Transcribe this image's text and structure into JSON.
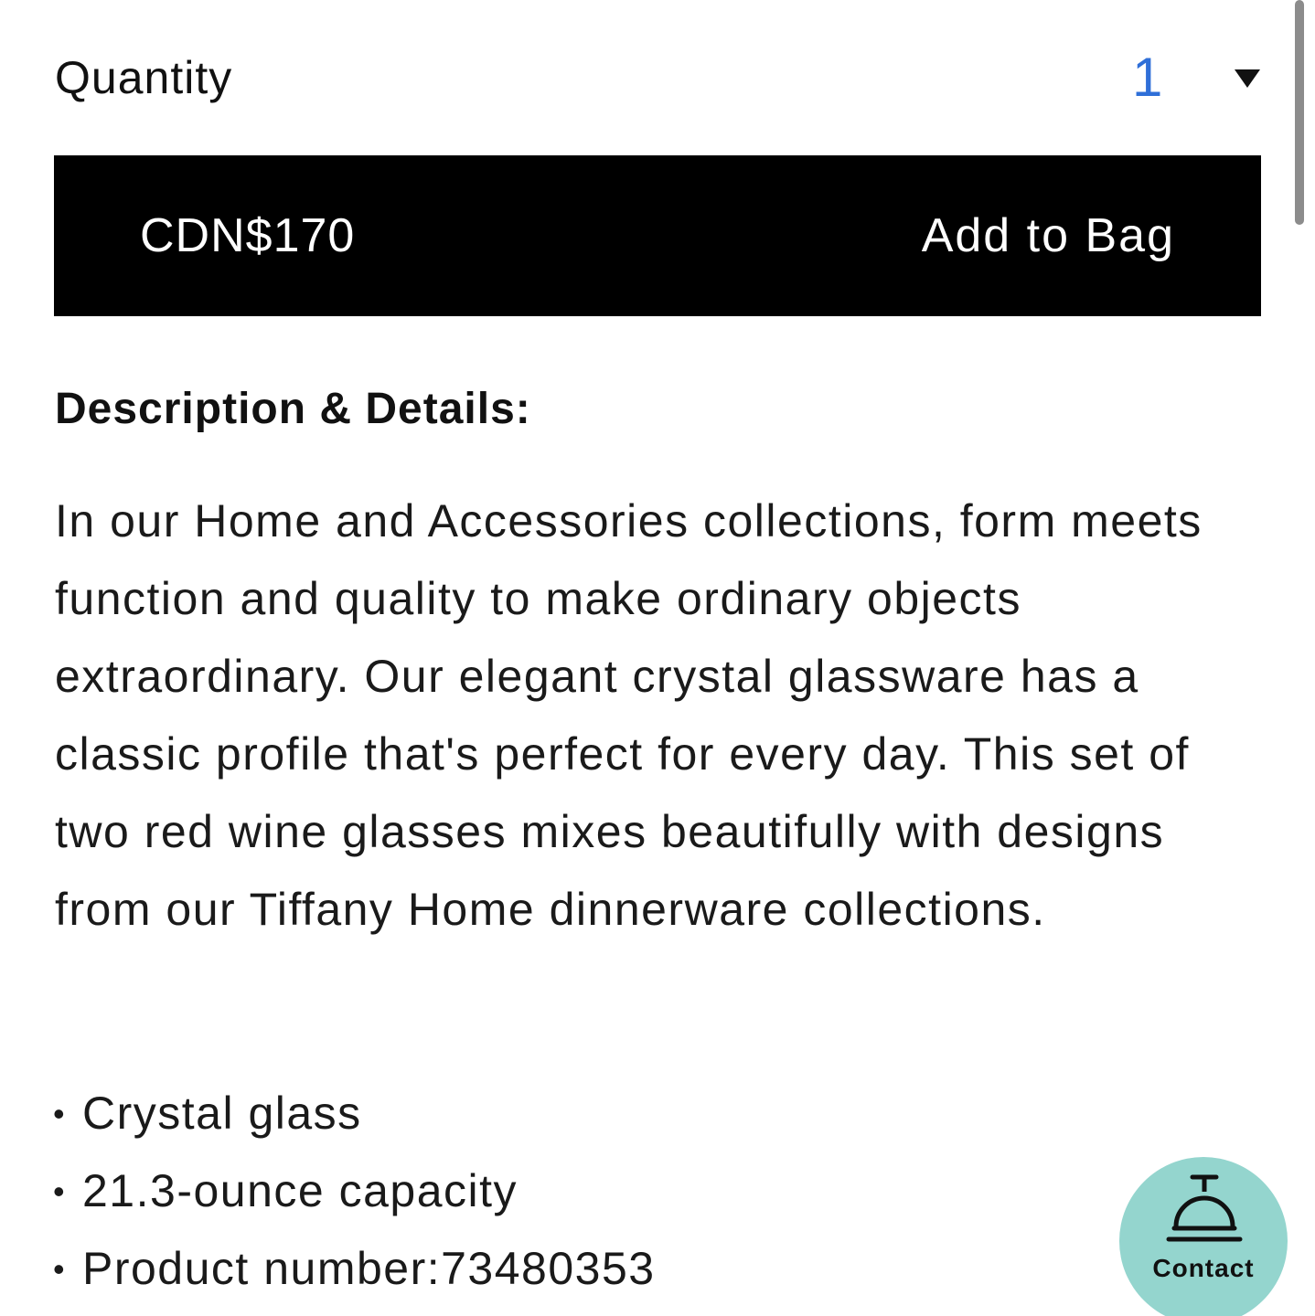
{
  "quantity": {
    "label": "Quantity",
    "selected": "1"
  },
  "add_to_bag": {
    "price": "CDN$170",
    "label": "Add to Bag"
  },
  "description": {
    "heading": "Description & Details:",
    "body": "In our Home and Accessories collections, form meets function and quality to make ordinary objects extraordinary. Our elegant crystal glassware has a classic profile that's perfect for every day. This set of two red wine glasses mixes beautifully with designs from our Tiffany Home dinnerware collections.",
    "details": [
      "Crystal glass",
      "21.3-ounce capacity",
      "Product number:73480353"
    ]
  },
  "contact": {
    "label": "Contact",
    "icon": "concierge-bell-icon",
    "color": "#94d5ce"
  },
  "colors": {
    "accent": "#2f6fd8",
    "button_bg": "#000000",
    "button_text": "#ffffff"
  }
}
